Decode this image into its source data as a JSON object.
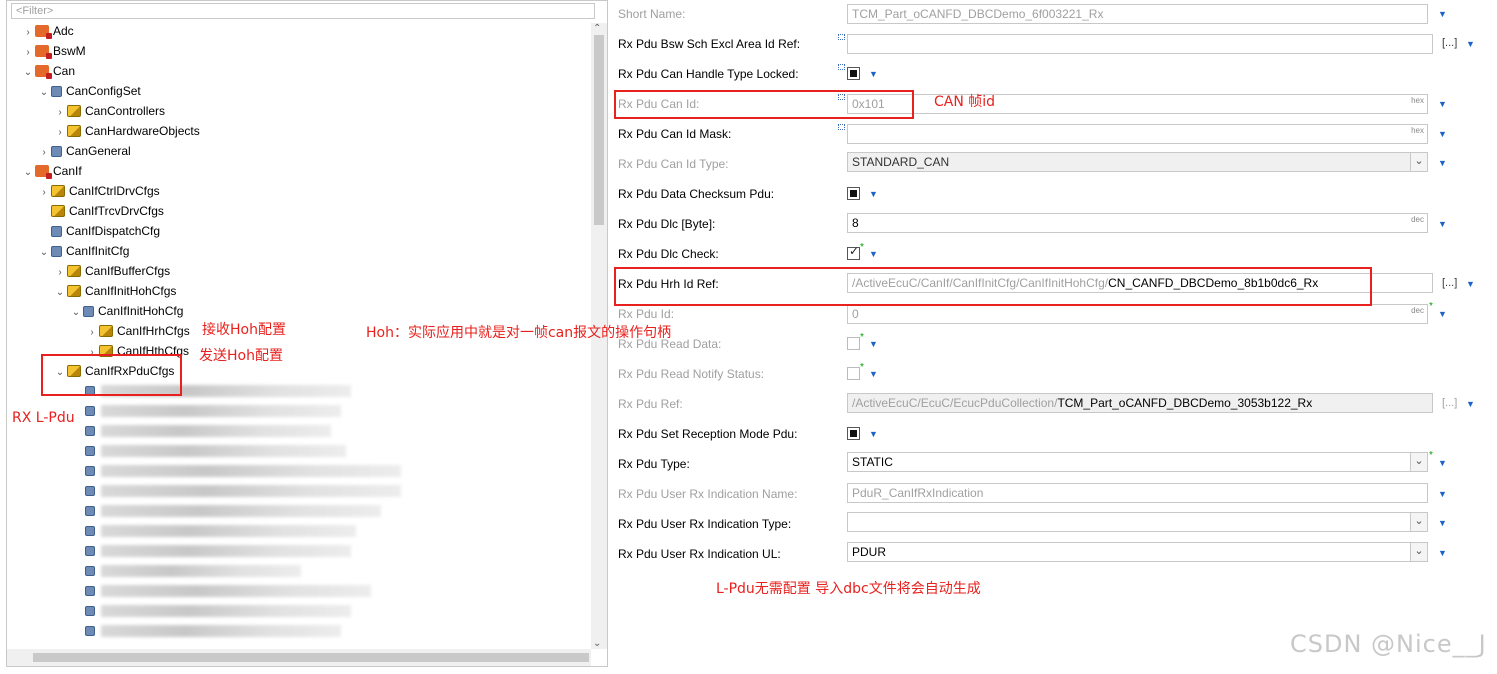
{
  "tree": {
    "filter_placeholder": "<Filter>",
    "items": [
      {
        "label": "Adc"
      },
      {
        "label": "BswM"
      },
      {
        "label": "Can"
      },
      {
        "label": "CanConfigSet"
      },
      {
        "label": "CanControllers"
      },
      {
        "label": "CanHardwareObjects"
      },
      {
        "label": "CanGeneral"
      },
      {
        "label": "CanIf"
      },
      {
        "label": "CanIfCtrlDrvCfgs"
      },
      {
        "label": "CanIfTrcvDrvCfgs"
      },
      {
        "label": "CanIfDispatchCfg"
      },
      {
        "label": "CanIfInitCfg"
      },
      {
        "label": "CanIfBufferCfgs"
      },
      {
        "label": "CanIfInitHohCfgs"
      },
      {
        "label": "CanIfInitHohCfg"
      },
      {
        "label": "CanIfHrhCfgs"
      },
      {
        "label": "CanIfHthCfgs"
      },
      {
        "label": "CanIfRxPduCfgs"
      }
    ]
  },
  "properties": {
    "short_name": {
      "label": "Short Name:",
      "value": "TCM_Part_oCANFD_DBCDemo_6f003221_Rx"
    },
    "bsw_sch": {
      "label": "Rx Pdu Bsw Sch Excl Area Id Ref:",
      "button": "[...]"
    },
    "handle_locked": {
      "label": "Rx Pdu Can Handle Type Locked:"
    },
    "can_id": {
      "label": "Rx Pdu Can Id:",
      "value": "0x101",
      "suffix": "hex"
    },
    "can_id_mask": {
      "label": "Rx Pdu Can Id Mask:",
      "suffix": "hex"
    },
    "can_id_type": {
      "label": "Rx Pdu Can Id Type:",
      "value": "STANDARD_CAN"
    },
    "checksum": {
      "label": "Rx Pdu Data Checksum Pdu:"
    },
    "dlc": {
      "label": "Rx Pdu Dlc [Byte]:",
      "value": "8",
      "suffix": "dec"
    },
    "dlc_check": {
      "label": "Rx Pdu Dlc Check:"
    },
    "hrh_ref": {
      "label": "Rx Pdu Hrh Id Ref:",
      "path": "/ActiveEcuC/CanIf/CanIfInitCfg/CanIfInitHohCfg/",
      "value": "CN_CANFD_DBCDemo_8b1b0dc6_Rx",
      "button": "[...]"
    },
    "pdu_id": {
      "label": "Rx Pdu Id:",
      "value": "0",
      "suffix": "dec"
    },
    "read_data": {
      "label": "Rx Pdu Read Data:"
    },
    "read_notify": {
      "label": "Rx Pdu Read Notify Status:"
    },
    "pdu_ref": {
      "label": "Rx Pdu Ref:",
      "path": "/ActiveEcuC/EcuC/EcucPduCollection/",
      "value": "TCM_Part_oCANFD_DBCDemo_3053b122_Rx",
      "button": "[...]"
    },
    "set_reception": {
      "label": "Rx Pdu Set Reception Mode Pdu:"
    },
    "pdu_type": {
      "label": "Rx Pdu Type:",
      "value": "STATIC"
    },
    "user_ind_name": {
      "label": "Rx Pdu User Rx Indication Name:",
      "value": "PduR_CanIfRxIndication"
    },
    "user_ind_type": {
      "label": "Rx Pdu User Rx Indication Type:",
      "value": ""
    },
    "user_ind_ul": {
      "label": "Rx Pdu User Rx Indication UL:",
      "value": "PDUR"
    }
  },
  "annotations": {
    "can_frame_id": "CAN 帧id",
    "hoh_desc": "Hoh：实际应用中就是对一帧can报文的操作句柄",
    "recv_hoh": "接收Hoh配置",
    "send_hoh": "发送Hoh配置",
    "rx_lpdu": "RX L-Pdu",
    "lpdu_note": "L-Pdu无需配置 导入dbc文件将会自动生成"
  },
  "watermark": "CSDN @Nice__J",
  "colors": {
    "annotation": "#e8211e",
    "dropdown_arrow": "#1e64c8",
    "required_star": "#00a000"
  }
}
